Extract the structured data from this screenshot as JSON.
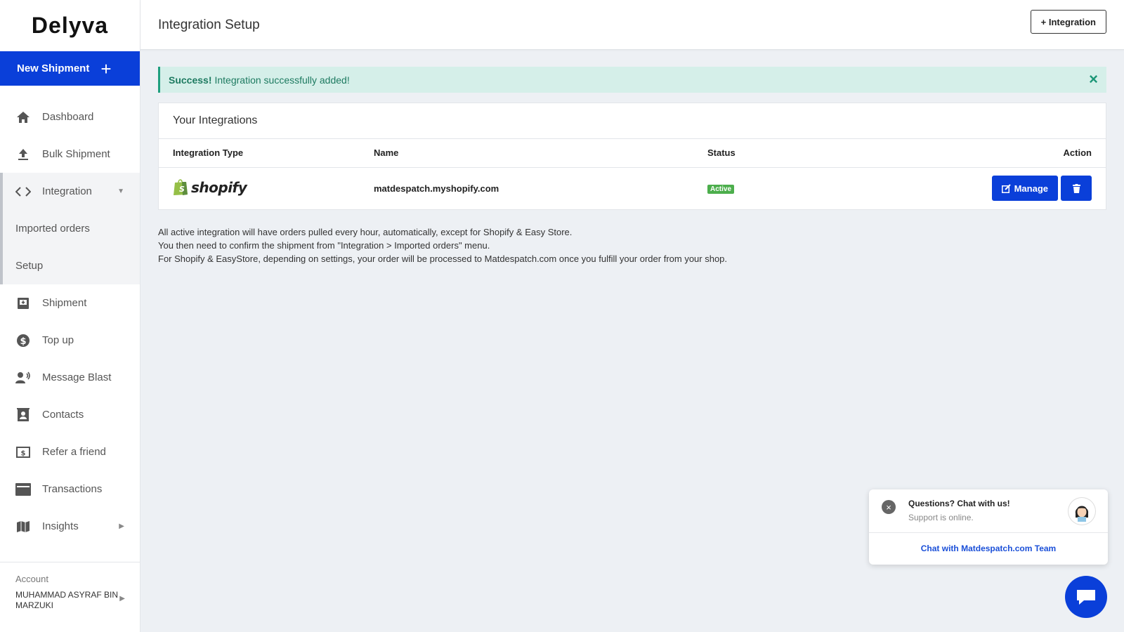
{
  "app": {
    "logo": "Delyva"
  },
  "sidebar": {
    "new_shipment_label": "New Shipment",
    "new_shipment_icon": "plus-icon",
    "items": [
      {
        "label": "Dashboard",
        "icon": "home-icon"
      },
      {
        "label": "Bulk Shipment",
        "icon": "upload-icon"
      },
      {
        "label": "Integration",
        "icon": "code-icon"
      },
      {
        "label": "Imported orders"
      },
      {
        "label": "Setup"
      },
      {
        "label": "Shipment",
        "icon": "inbox-icon"
      },
      {
        "label": "Top up",
        "icon": "dollar-icon"
      },
      {
        "label": "Message Blast",
        "icon": "broadcast-icon"
      },
      {
        "label": "Contacts",
        "icon": "contacts-icon"
      },
      {
        "label": "Refer a friend",
        "icon": "money-icon"
      },
      {
        "label": "Transactions",
        "icon": "card-icon"
      },
      {
        "label": "Insights",
        "icon": "map-icon"
      }
    ],
    "account": {
      "label": "Account",
      "name": "MUHAMMAD ASYRAF BIN MARZUKI"
    }
  },
  "header": {
    "title": "Integration Setup",
    "add_button": "+ Integration"
  },
  "alert": {
    "strong": "Success!",
    "message": "Integration successfully added!"
  },
  "integrations": {
    "title": "Your Integrations",
    "columns": [
      "Integration Type",
      "Name",
      "Status",
      "Action"
    ],
    "rows": [
      {
        "type": "shopify",
        "name": "matdespatch.myshopify.com",
        "status": "Active",
        "manage": "Manage"
      }
    ]
  },
  "notes": [
    "All active integration will have orders pulled every hour, automatically, except for Shopify & Easy Store.",
    "You then need to confirm the shipment from \"Integration > Imported orders\" menu.",
    "For Shopify & EasyStore, depending on settings, your order will be processed to Matdespatch.com once you fulfill your order from your shop."
  ],
  "chat": {
    "question": "Questions? Chat with us!",
    "status": "Support is online.",
    "link": "Chat with Matdespatch.com Team"
  },
  "colors": {
    "primary": "#0a3fd9",
    "success_bg": "#d5efe9",
    "success_text": "#1d7a60",
    "active_badge": "#4cae4c"
  }
}
